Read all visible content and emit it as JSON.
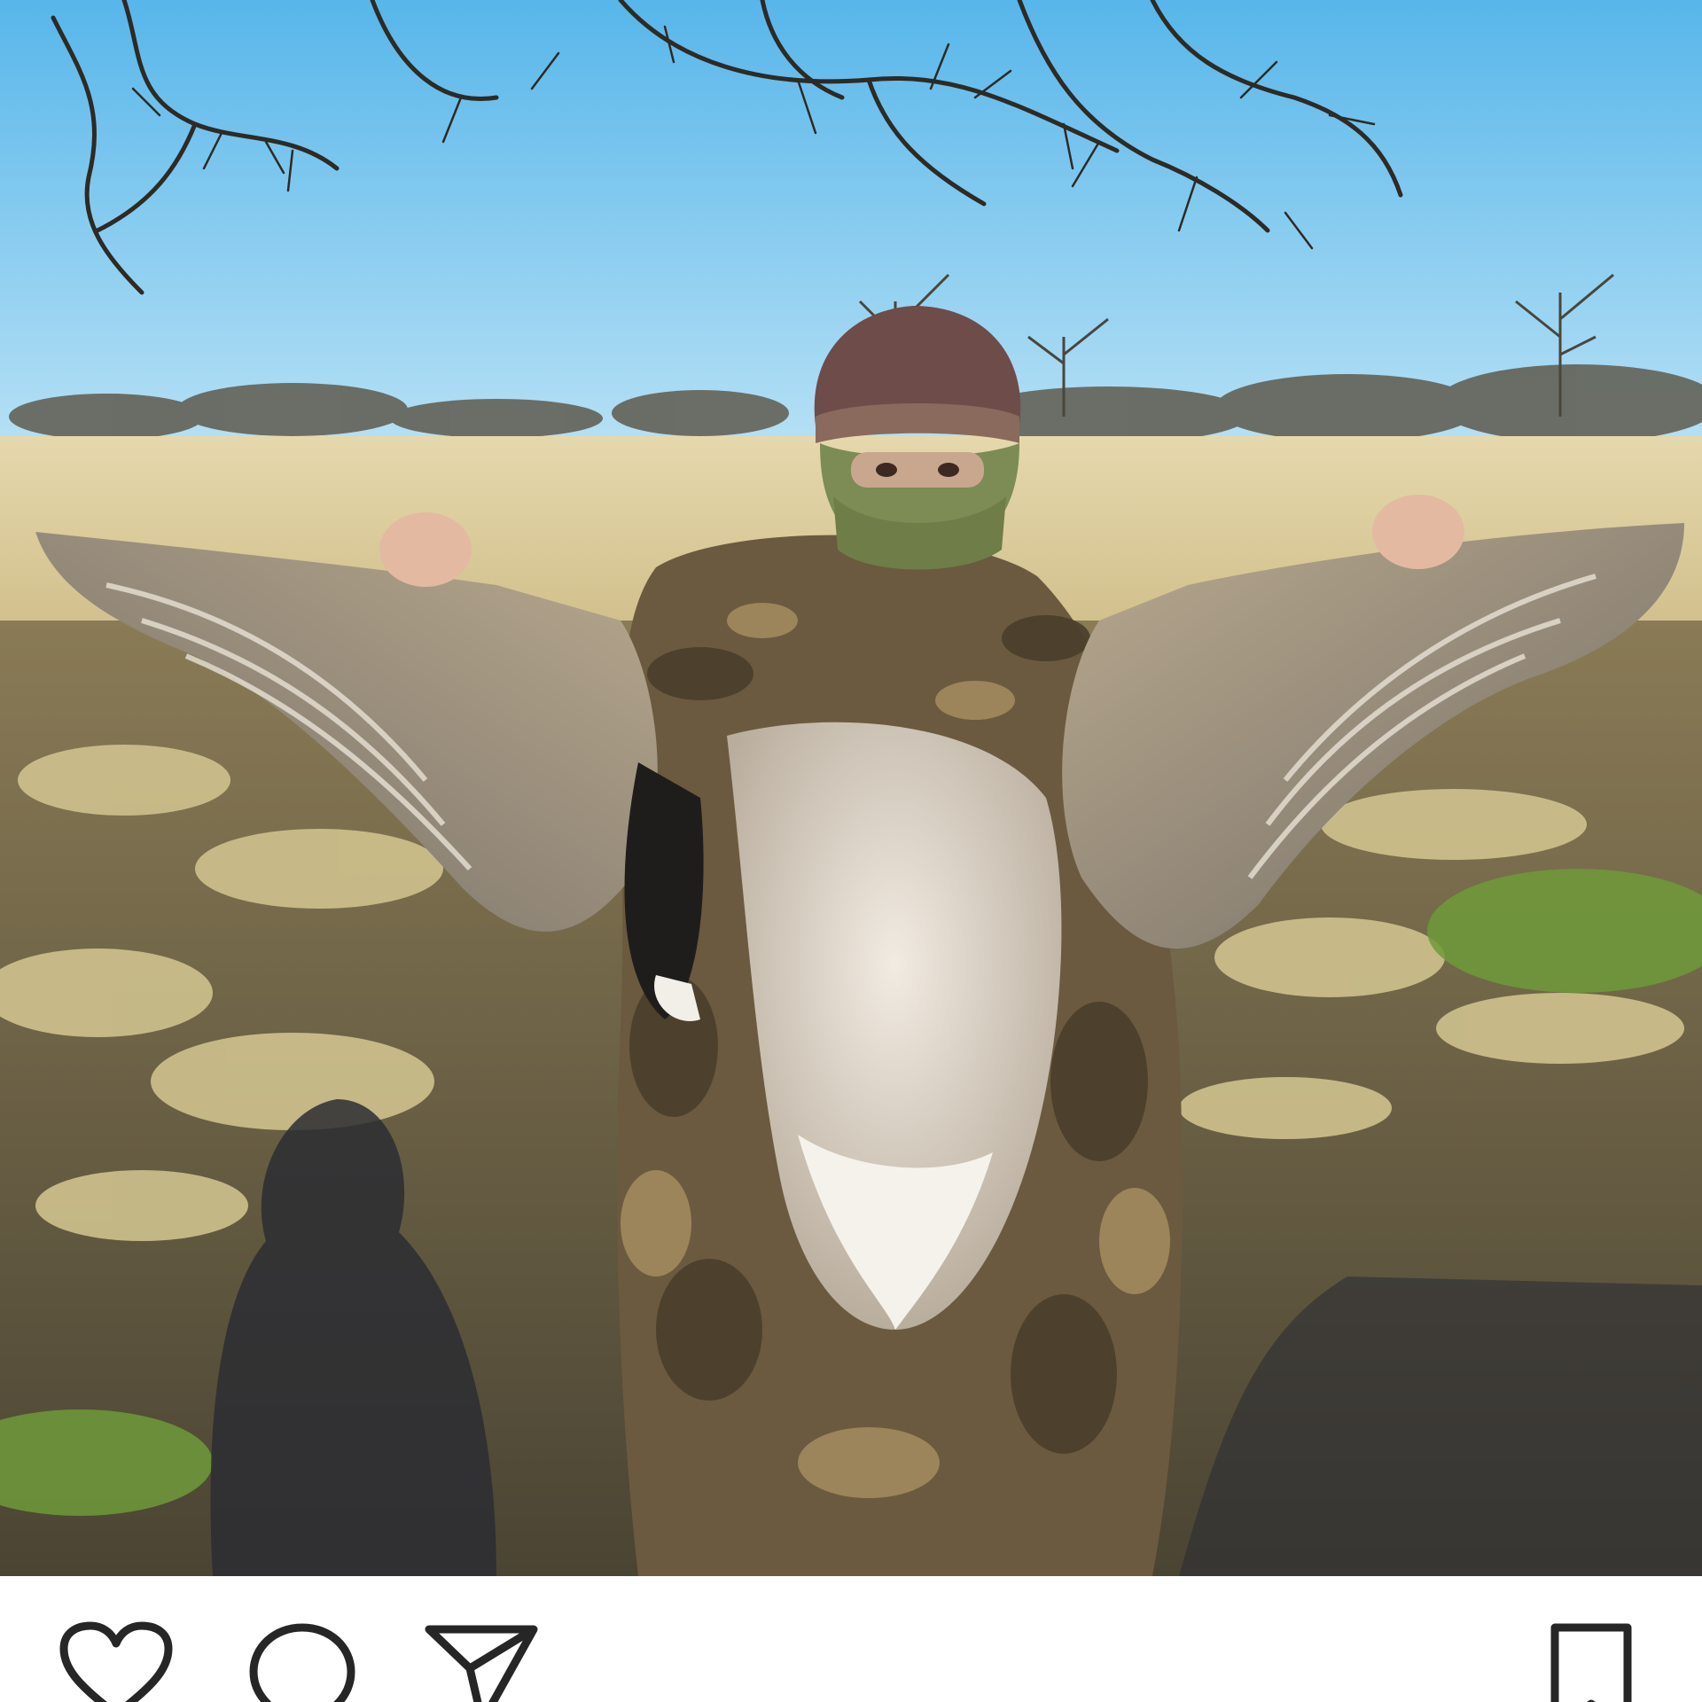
{
  "post": {
    "photo": {
      "kind": "hunting-photo",
      "subject": "person-with-goose-spread-wings"
    },
    "actions": {
      "like": {
        "icon": "heart-icon"
      },
      "comment": {
        "icon": "comment-bubble-icon"
      },
      "share": {
        "icon": "paper-plane-icon"
      },
      "save": {
        "icon": "bookmark-icon"
      }
    }
  },
  "colors": {
    "sky": "#7fc8ee",
    "field": "#d8c99a",
    "icon_stroke": "#262626",
    "background": "#ffffff"
  }
}
